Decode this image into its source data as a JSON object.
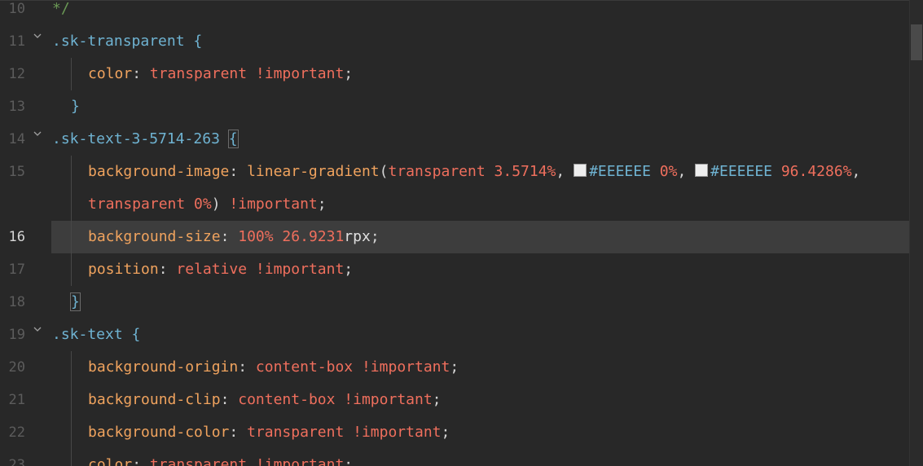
{
  "editor": {
    "lines": [
      {
        "num": "10",
        "tokens": [
          {
            "t": "*/",
            "c": "tok-com"
          }
        ]
      },
      {
        "num": "11",
        "fold": true,
        "tokens": [
          {
            "t": ".sk-transparent",
            "c": "tok-sel"
          },
          {
            "t": " {",
            "c": "tok-brace"
          }
        ]
      },
      {
        "num": "12",
        "indent": 1,
        "tokens": [
          {
            "t": "color",
            "c": "tok-prop"
          },
          {
            "t": ": ",
            "c": "tok-punc"
          },
          {
            "t": "transparent !important",
            "c": "tok-val"
          },
          {
            "t": ";",
            "c": "tok-punc"
          }
        ]
      },
      {
        "num": "13",
        "brace": true,
        "tokens": [
          {
            "t": "}",
            "c": "tok-brace"
          }
        ]
      },
      {
        "num": "14",
        "fold": true,
        "tokens": [
          {
            "t": ".sk-text-3-5714-263",
            "c": "tok-sel"
          },
          {
            "t": " ",
            "c": "tok-plain"
          },
          {
            "t": "{",
            "c": "tok-brace",
            "box": true
          }
        ]
      },
      {
        "num": "15",
        "indent": 1,
        "tokens": [
          {
            "t": "background-image",
            "c": "tok-prop"
          },
          {
            "t": ": ",
            "c": "tok-punc"
          },
          {
            "t": "linear-gradient",
            "c": "tok-fn"
          },
          {
            "t": "(",
            "c": "tok-punc"
          },
          {
            "t": "transparent 3.5714%",
            "c": "tok-val"
          },
          {
            "t": ", ",
            "c": "tok-punc"
          },
          {
            "swatch": true
          },
          {
            "t": "#EEEEEE",
            "c": "tok-hex"
          },
          {
            "t": " 0%",
            "c": "tok-val"
          },
          {
            "t": ", ",
            "c": "tok-punc"
          },
          {
            "swatch": true
          },
          {
            "t": "#EEEEEE",
            "c": "tok-hex"
          },
          {
            "t": " 96.4286%",
            "c": "tok-val"
          },
          {
            "t": ",",
            "c": "tok-punc"
          }
        ]
      },
      {
        "num": "",
        "indent": 1,
        "tokens": [
          {
            "t": "transparent 0%",
            "c": "tok-val"
          },
          {
            "t": ")",
            "c": "tok-punc"
          },
          {
            "t": " !important",
            "c": "tok-val"
          },
          {
            "t": ";",
            "c": "tok-punc"
          }
        ]
      },
      {
        "num": "16",
        "current": true,
        "indent": 1,
        "tokens": [
          {
            "t": "background-size",
            "c": "tok-prop"
          },
          {
            "t": ": ",
            "c": "tok-punc"
          },
          {
            "t": "100% 26.9231",
            "c": "tok-val"
          },
          {
            "t": "rpx",
            "c": "tok-plain"
          },
          {
            "t": ";",
            "c": "tok-punc"
          }
        ]
      },
      {
        "num": "17",
        "indent": 1,
        "tokens": [
          {
            "t": "position",
            "c": "tok-prop"
          },
          {
            "t": ": ",
            "c": "tok-punc"
          },
          {
            "t": "relative !important",
            "c": "tok-val"
          },
          {
            "t": ";",
            "c": "tok-punc"
          }
        ]
      },
      {
        "num": "18",
        "brace": true,
        "tokens": [
          {
            "t": "}",
            "c": "tok-brace",
            "box": true
          }
        ]
      },
      {
        "num": "19",
        "fold": true,
        "tokens": [
          {
            "t": ".sk-text",
            "c": "tok-sel"
          },
          {
            "t": " {",
            "c": "tok-brace"
          }
        ]
      },
      {
        "num": "20",
        "indent": 1,
        "tokens": [
          {
            "t": "background-origin",
            "c": "tok-prop"
          },
          {
            "t": ": ",
            "c": "tok-punc"
          },
          {
            "t": "content-box !important",
            "c": "tok-val"
          },
          {
            "t": ";",
            "c": "tok-punc"
          }
        ]
      },
      {
        "num": "21",
        "indent": 1,
        "tokens": [
          {
            "t": "background-clip",
            "c": "tok-prop"
          },
          {
            "t": ": ",
            "c": "tok-punc"
          },
          {
            "t": "content-box !important",
            "c": "tok-val"
          },
          {
            "t": ";",
            "c": "tok-punc"
          }
        ]
      },
      {
        "num": "22",
        "indent": 1,
        "tokens": [
          {
            "t": "background-color",
            "c": "tok-prop"
          },
          {
            "t": ": ",
            "c": "tok-punc"
          },
          {
            "t": "transparent !important",
            "c": "tok-val"
          },
          {
            "t": ";",
            "c": "tok-punc"
          }
        ]
      },
      {
        "num": "23",
        "indent": 1,
        "tokens": [
          {
            "t": "color",
            "c": "tok-prop"
          },
          {
            "t": ": ",
            "c": "tok-punc"
          },
          {
            "t": "transparent !important",
            "c": "tok-val"
          },
          {
            "t": ";",
            "c": "tok-punc"
          }
        ]
      }
    ]
  },
  "colors": {
    "background": "#282828",
    "selector": "#6fb3d2",
    "property": "#f0a35e",
    "value": "#ef6f5d",
    "comment": "#6a9955",
    "current_line": "#3d3d3d"
  }
}
